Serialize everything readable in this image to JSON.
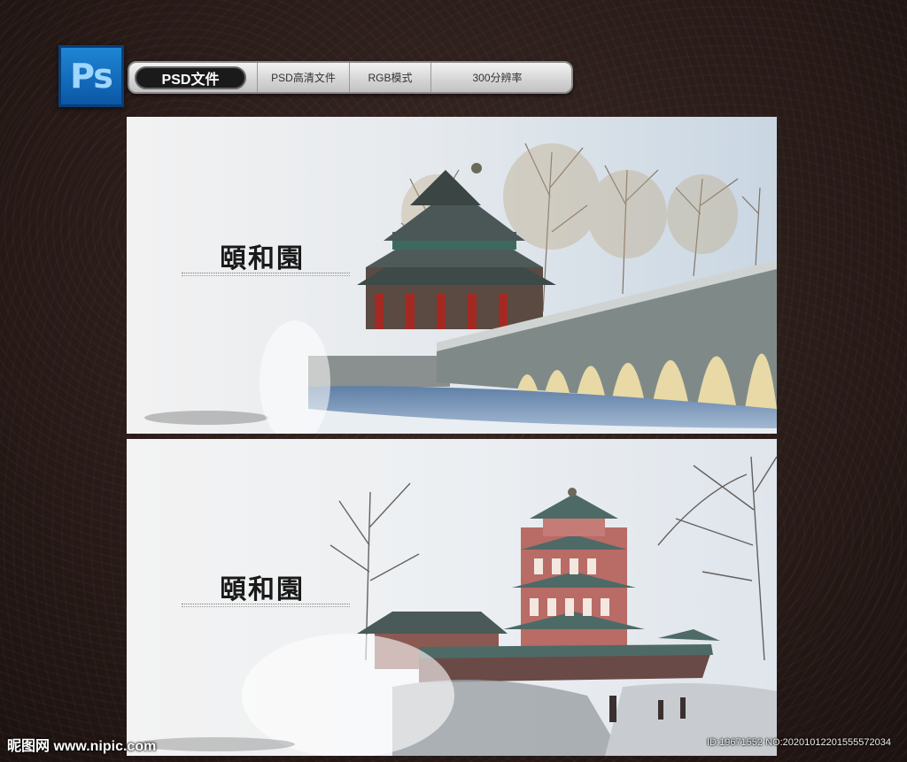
{
  "logo": {
    "text": "Ps"
  },
  "info_bar": {
    "badge": "PSD文件",
    "items": [
      "PSD高清文件",
      "RGB模式",
      "300分辨率"
    ]
  },
  "panels": [
    {
      "title": "頤和園"
    },
    {
      "title": "頤和園"
    }
  ],
  "watermark": {
    "site": "昵图网 www.nipic.com",
    "id": "ID:19671552 NO:20201012201555572034"
  },
  "colors": {
    "ps_blue": "#0b57a6",
    "background": "#2a1c19",
    "panel_bg": "#eeeeee"
  }
}
